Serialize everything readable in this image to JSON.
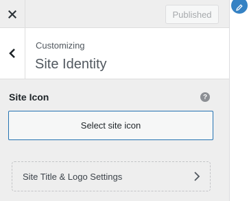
{
  "topbar": {
    "close_icon": "close-icon",
    "publish_label": "Published"
  },
  "header": {
    "back_icon": "chevron-left-icon",
    "breadcrumb": "Customizing",
    "title": "Site Identity"
  },
  "site_icon": {
    "label": "Site Icon",
    "help_icon": "question-circle-icon",
    "help_glyph": "?",
    "button_label": "Select site icon"
  },
  "logo_settings": {
    "label": "Site Title & Logo Settings",
    "chevron_icon": "chevron-right-icon"
  },
  "preview": {
    "edit_icon": "pencil-icon"
  },
  "colors": {
    "panel_bg": "#eeeeee",
    "accent": "#2271b1",
    "edit_shortcut": "#3582c4"
  }
}
